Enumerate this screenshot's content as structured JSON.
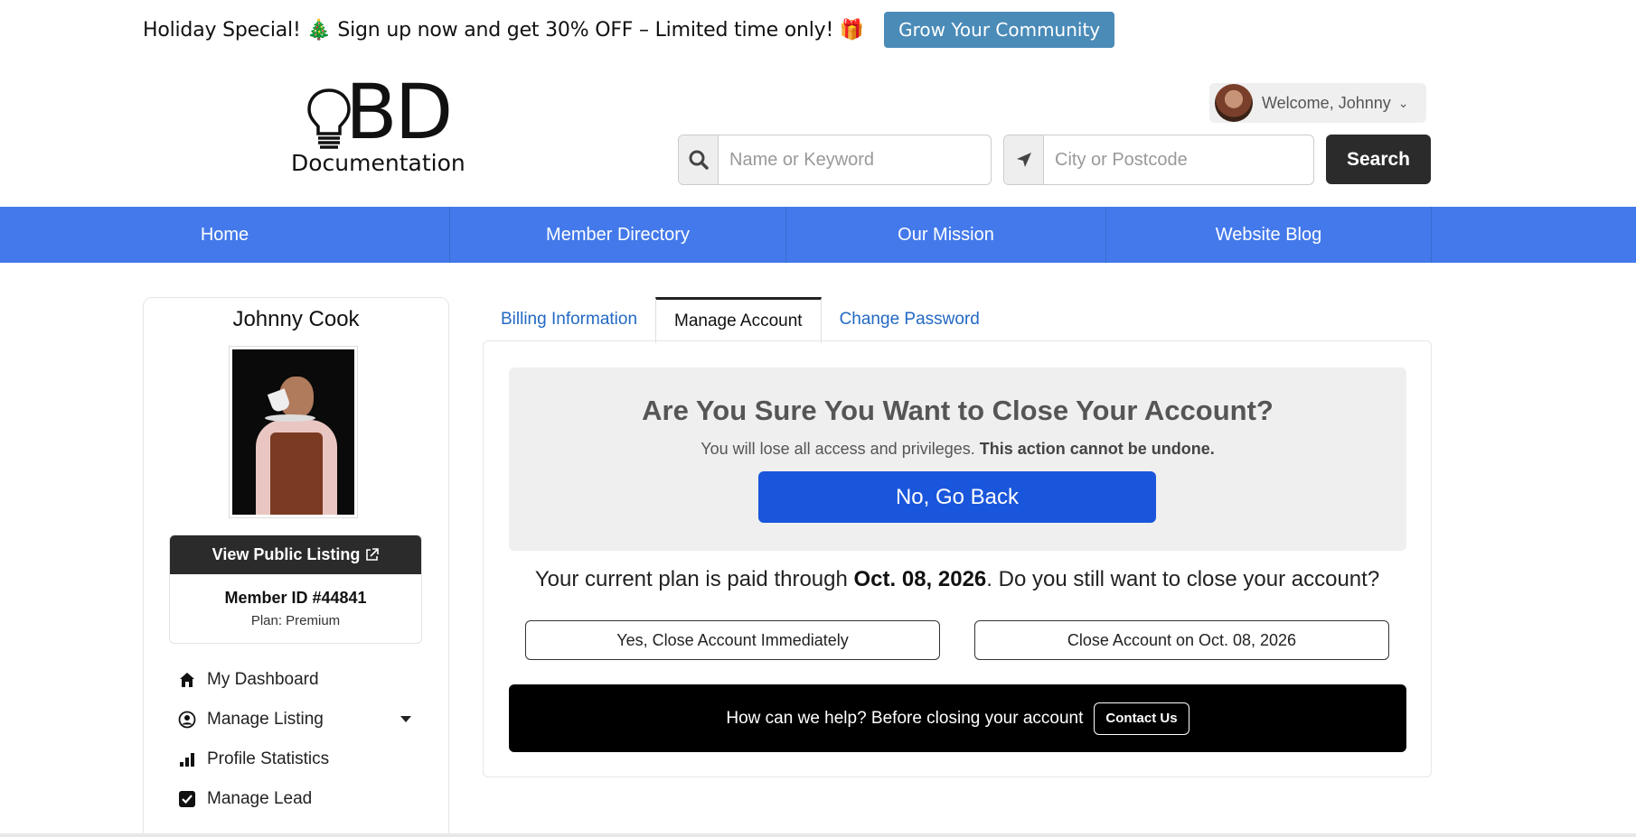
{
  "promo": {
    "text": "Holiday Special! 🎄 Sign up now and get 30% OFF – Limited time only! 🎁",
    "button_label": "Grow Your Community"
  },
  "logo": {
    "mark_text": "BD",
    "subtitle": "Documentation"
  },
  "user_menu": {
    "welcome_label": "Welcome, Johnny"
  },
  "search": {
    "keyword_placeholder": "Name or Keyword",
    "keyword_value": "",
    "location_placeholder": "City or Postcode",
    "location_value": "",
    "button_label": "Search"
  },
  "nav": {
    "items": [
      {
        "label": "Home"
      },
      {
        "label": "Member Directory"
      },
      {
        "label": "Our Mission"
      },
      {
        "label": "Website Blog"
      }
    ]
  },
  "sidebar": {
    "name": "Johnny Cook",
    "view_listing_label": "View Public Listing",
    "member_id": "Member ID #44841",
    "plan": "Plan: Premium",
    "menu": [
      {
        "label": "My Dashboard",
        "icon": "home-icon"
      },
      {
        "label": "Manage Listing",
        "icon": "user-circle-icon"
      },
      {
        "label": "Profile Statistics",
        "icon": "bar-chart-icon"
      },
      {
        "label": "Manage Lead",
        "icon": "checkbox-icon"
      }
    ]
  },
  "tabs": [
    {
      "label": "Billing Information"
    },
    {
      "label": "Manage Account",
      "active": true
    },
    {
      "label": "Change Password"
    }
  ],
  "close_account": {
    "title": "Are You Sure You Want to Close Your Account?",
    "subtitle_plain": "You will lose all access and privileges.",
    "subtitle_bold": "This action cannot be undone.",
    "go_back_label": "No, Go Back",
    "plan_prefix": "Your current plan is paid through",
    "plan_date": "Oct. 08, 2026",
    "plan_suffix": ". Do you still want to close your account?",
    "close_now_label": "Yes, Close Account Immediately",
    "close_later_label": "Close Account on Oct. 08, 2026",
    "help_text": "How can we help? Before closing your account",
    "contact_label": "Contact Us"
  },
  "colors": {
    "nav_bg": "#4379ea",
    "primary_button": "#1a56db",
    "promo_button": "#4a8bb8",
    "dark_button": "#2b2b2b",
    "tab_link": "#2369c4"
  }
}
